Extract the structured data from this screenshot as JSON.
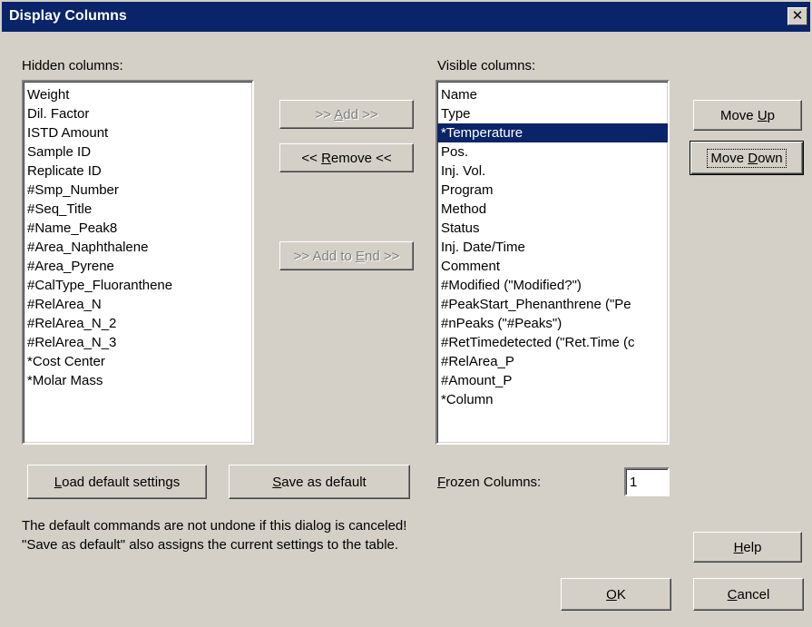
{
  "window": {
    "title": "Display Columns",
    "close_glyph": "✕"
  },
  "hidden": {
    "label": "Hidden columns:",
    "items": [
      "Weight",
      "Dil. Factor",
      "ISTD Amount",
      "Sample ID",
      "Replicate ID",
      "#Smp_Number",
      "#Seq_Title",
      "#Name_Peak8",
      "#Area_Naphthalene",
      "#Area_Pyrene",
      "#CalType_Fluoranthene",
      "#RelArea_N",
      "#RelArea_N_2",
      "#RelArea_N_3",
      "*Cost Center",
      " *Molar Mass"
    ]
  },
  "visible": {
    "label": "Visible columns:",
    "items": [
      "Name",
      "Type",
      "*Temperature",
      "Pos.",
      "Inj. Vol.",
      "Program",
      "Method",
      "Status",
      "Inj. Date/Time",
      "Comment",
      "#Modified (\"Modified?\")",
      "#PeakStart_Phenanthrene (\"Pe",
      "#nPeaks (\"#Peaks\")",
      "#RetTimedetected (\"Ret.Time (c",
      "#RelArea_P",
      "#Amount_P",
      "*Column"
    ],
    "selected_index": 2
  },
  "buttons": {
    "add": {
      "pre": ">> ",
      "key": "A",
      "post": "dd >>"
    },
    "remove": {
      "pre": "<< ",
      "key": "R",
      "post": "emove <<"
    },
    "add_to_end": {
      "pre": ">> Add to ",
      "key": "E",
      "post": "nd >>"
    },
    "move_up": {
      "pre": "Move ",
      "key": "U",
      "post": "p"
    },
    "move_down": {
      "pre": "Move ",
      "key": "D",
      "post": "own"
    },
    "load_default": {
      "pre": "",
      "key": "L",
      "post": "oad default settings"
    },
    "save_default": {
      "pre": "",
      "key": "S",
      "post": "ave as default"
    },
    "help": {
      "pre": "",
      "key": "H",
      "post": "elp"
    },
    "ok": {
      "pre": "",
      "key": "O",
      "post": "K"
    },
    "cancel": {
      "pre": "",
      "key": "C",
      "post": "ancel"
    }
  },
  "frozen": {
    "label_key": "F",
    "label_rest": "rozen Columns:",
    "value": "1"
  },
  "notes": {
    "line1": "The default commands are not undone if this dialog is canceled!",
    "line2": "\"Save as default\" also assigns the current settings to the table."
  }
}
